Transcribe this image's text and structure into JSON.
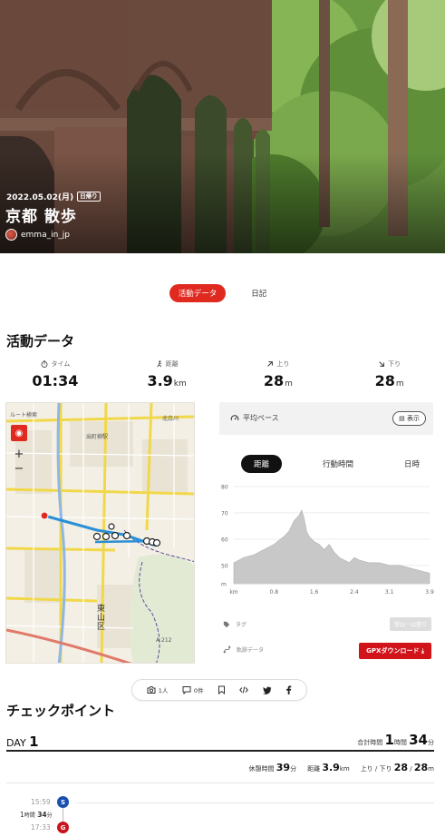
{
  "hero": {
    "date": "2022.05.02(月)",
    "badge": "日帰り",
    "title": "京都 散歩",
    "username": "emma_in_jp"
  },
  "tabs": [
    {
      "label": "活動データ",
      "active": true
    },
    {
      "label": "日記",
      "active": false
    }
  ],
  "activity": {
    "section_title": "活動データ",
    "stats": [
      {
        "label": "タイム",
        "icon": "stopwatch-icon",
        "value": "01:34",
        "unit": ""
      },
      {
        "label": "距離",
        "icon": "walker-icon",
        "value": "3.9",
        "unit": "km"
      },
      {
        "label": "上り",
        "icon": "arrow-up-right-icon",
        "value": "28",
        "unit": "m"
      },
      {
        "label": "下り",
        "icon": "arrow-down-right-icon",
        "value": "28",
        "unit": "m"
      }
    ]
  },
  "map": {
    "labels": [
      "ルート検索",
      "北白川",
      "出町柳駅",
      "東山区",
      "A 212"
    ]
  },
  "pace": {
    "label": "平均ペース",
    "button": "表示"
  },
  "chart_tabs": [
    {
      "label": "距離",
      "active": true
    },
    {
      "label": "行動時間",
      "active": false
    },
    {
      "label": "日時",
      "active": false
    }
  ],
  "chart_data": {
    "type": "area",
    "x": [
      0,
      0.2,
      0.4,
      0.6,
      0.8,
      1.0,
      1.1,
      1.2,
      1.3,
      1.35,
      1.4,
      1.45,
      1.5,
      1.6,
      1.7,
      1.8,
      1.9,
      2.0,
      2.1,
      2.2,
      2.3,
      2.4,
      2.5,
      2.7,
      2.9,
      3.1,
      3.3,
      3.5,
      3.7,
      3.9
    ],
    "y": [
      51,
      53,
      54,
      56,
      58,
      61,
      63,
      67,
      69,
      71,
      68,
      63,
      61,
      59,
      58,
      56,
      58,
      55,
      53,
      52,
      51,
      53,
      52,
      51,
      51,
      50,
      50,
      49,
      48,
      47
    ],
    "xlabel": "km",
    "xticks": [
      "km",
      "0.8",
      "1.6",
      "2.4",
      "3.1",
      "3.9"
    ],
    "yticks": [
      "m",
      "50",
      "60",
      "70",
      "80"
    ],
    "ylim": [
      43,
      80
    ],
    "xlim": [
      0,
      3.9
    ],
    "fill_color": "#c8c8c8"
  },
  "meta": {
    "tag_label": "タグ",
    "tag_chip": "登山・山登り",
    "track_label": "軌跡データ",
    "gpx_button": "GPXダウンロード"
  },
  "actions": [
    {
      "icon": "camera-icon",
      "label": "1人"
    },
    {
      "icon": "comment-icon",
      "label": "0件"
    },
    {
      "icon": "bookmark-icon",
      "label": ""
    },
    {
      "icon": "embed-icon",
      "label": ""
    },
    {
      "icon": "twitter-icon",
      "label": ""
    },
    {
      "icon": "facebook-icon",
      "label": ""
    }
  ],
  "checkpoints": {
    "section_title": "チェックポイント",
    "day_prefix": "DAY",
    "day_number": "1",
    "total_label": "合計時間",
    "total_hours": "1",
    "hours_unit": "時間",
    "total_minutes": "34",
    "minutes_unit": "分",
    "rest_label": "休憩時間",
    "rest_value": "39",
    "rest_unit": "分",
    "distance_label": "距離",
    "distance_value": "3.9",
    "distance_unit": "km",
    "updown_label": "上り / 下り",
    "up_value": "28",
    "down_value": "28",
    "updown_unit": "m",
    "timeline": [
      {
        "time": "15:59",
        "mark": "S",
        "color": "#1a4fb0"
      },
      {
        "duration_h": "1",
        "duration_h_unit": "時間",
        "duration_m": "34",
        "duration_m_unit": "分"
      },
      {
        "time": "17:33",
        "mark": "G",
        "color": "#c8141a"
      }
    ]
  },
  "colors": {
    "accent": "#e02a20",
    "route": "#2a8fd6"
  }
}
